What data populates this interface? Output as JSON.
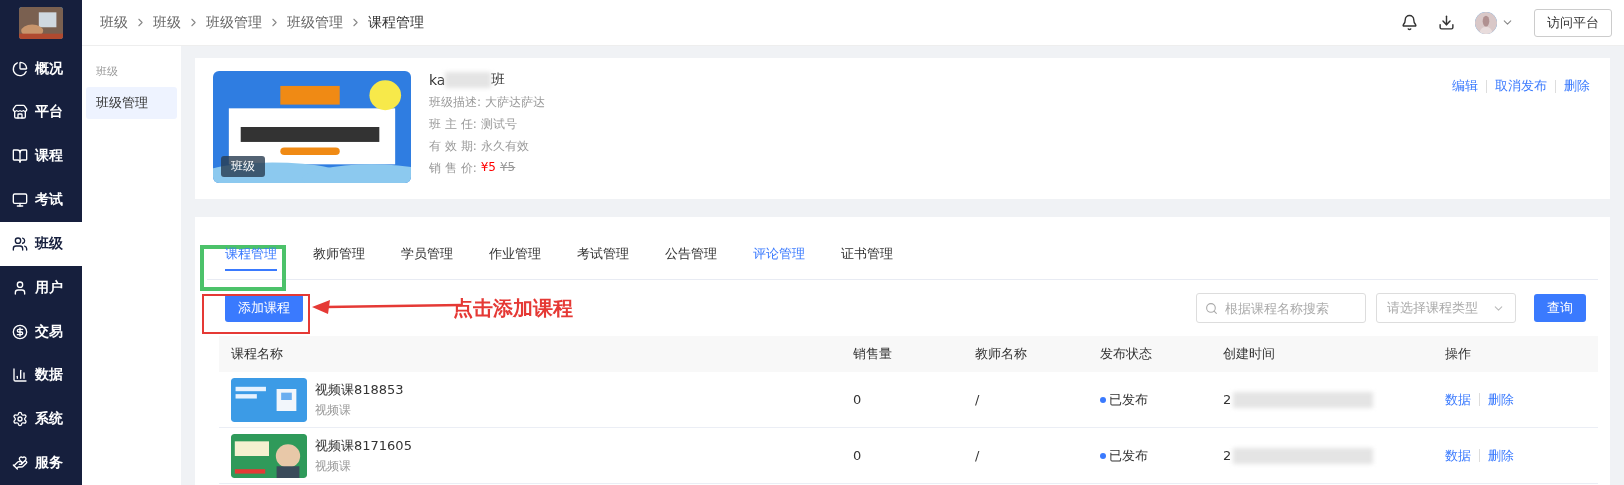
{
  "sidebar": {
    "items": [
      {
        "label": "概况",
        "selected": false
      },
      {
        "label": "平台",
        "selected": false
      },
      {
        "label": "课程",
        "selected": false
      },
      {
        "label": "考试",
        "selected": false
      },
      {
        "label": "班级",
        "selected": true
      },
      {
        "label": "用户",
        "selected": false
      },
      {
        "label": "交易",
        "selected": false
      },
      {
        "label": "数据",
        "selected": false
      },
      {
        "label": "系统",
        "selected": false
      },
      {
        "label": "服务",
        "selected": false
      }
    ]
  },
  "breadcrumbs": [
    "班级",
    "班级",
    "班级管理",
    "班级管理",
    "课程管理"
  ],
  "header": {
    "visit_button": "访问平台"
  },
  "subnav": {
    "group": "班级",
    "items": [
      {
        "label": "班级管理",
        "selected": true
      }
    ]
  },
  "class_card": {
    "badge": "班级",
    "title_start": "ka",
    "title_end": "班",
    "fields": [
      {
        "label": "班级描述:",
        "value": "大萨达萨达"
      },
      {
        "label": "班 主 任:",
        "value": "测试号"
      },
      {
        "label": "有 效 期:",
        "value": "永久有效"
      }
    ],
    "price_label": "销 售 价:",
    "price": "¥5",
    "original_price": "¥5",
    "actions": [
      "编辑",
      "取消发布",
      "删除"
    ]
  },
  "tabs": [
    {
      "label": "课程管理",
      "selected": true,
      "hover": false
    },
    {
      "label": "教师管理",
      "selected": false,
      "hover": false
    },
    {
      "label": "学员管理",
      "selected": false,
      "hover": false
    },
    {
      "label": "作业管理",
      "selected": false,
      "hover": false
    },
    {
      "label": "考试管理",
      "selected": false,
      "hover": false
    },
    {
      "label": "公告管理",
      "selected": false,
      "hover": false
    },
    {
      "label": "评论管理",
      "selected": false,
      "hover": true
    },
    {
      "label": "证书管理",
      "selected": false,
      "hover": false
    }
  ],
  "add_button": "添加课程",
  "annotation": "点击添加课程",
  "search": {
    "placeholder": "根据课程名称搜索"
  },
  "type_select": {
    "placeholder": "请选择课程类型"
  },
  "query_button": "查询",
  "table": {
    "columns": [
      "课程名称",
      "销售量",
      "教师名称",
      "发布状态",
      "创建时间",
      "操作"
    ],
    "rows": [
      {
        "name": "视频课818853",
        "type": "视频课",
        "sales": "0",
        "teacher": "/",
        "status": "已发布",
        "color": "#3a7afe",
        "created": "2",
        "actions": [
          "数据",
          "删除"
        ]
      },
      {
        "name": "视频课8171605",
        "type": "视频课",
        "sales": "0",
        "teacher": "/",
        "status": "已发布",
        "color": "#3a7afe",
        "created": "2",
        "actions": [
          "数据",
          "删除"
        ]
      }
    ]
  }
}
